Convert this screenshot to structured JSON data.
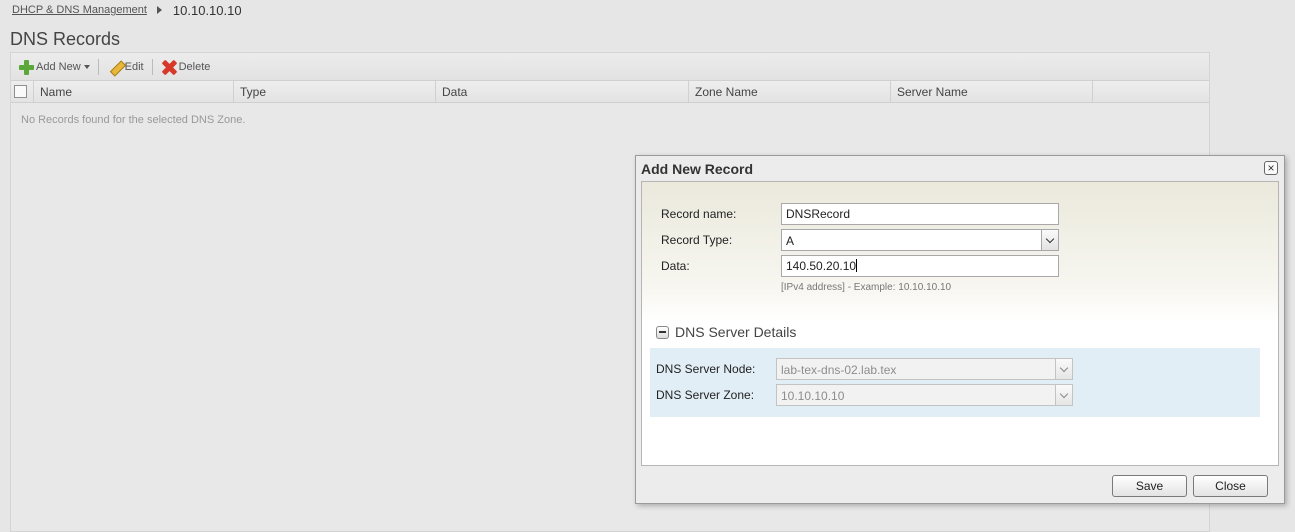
{
  "breadcrumb": {
    "parent": "DHCP & DNS Management",
    "current": "10.10.10.10"
  },
  "page_title": "DNS Records",
  "toolbar": {
    "add_new": "Add New",
    "edit": "Edit",
    "delete": "Delete"
  },
  "grid": {
    "columns": [
      "Name",
      "Type",
      "Data",
      "Zone Name",
      "Server Name"
    ],
    "empty_message": "No Records found for the selected DNS Zone."
  },
  "dialog": {
    "title": "Add New Record",
    "fields": {
      "record_name_label": "Record name:",
      "record_name_value": "DNSRecord",
      "record_type_label": "Record Type:",
      "record_type_value": "A",
      "data_label": "Data:",
      "data_value": "140.50.20.10",
      "data_hint": "[IPv4 address] - Example: 10.10.10.10"
    },
    "server_section": {
      "title": "DNS Server Details",
      "node_label": "DNS Server Node:",
      "node_value": "lab-tex-dns-02.lab.tex",
      "zone_label": "DNS Server Zone:",
      "zone_value": "10.10.10.10"
    },
    "save": "Save",
    "close": "Close"
  }
}
